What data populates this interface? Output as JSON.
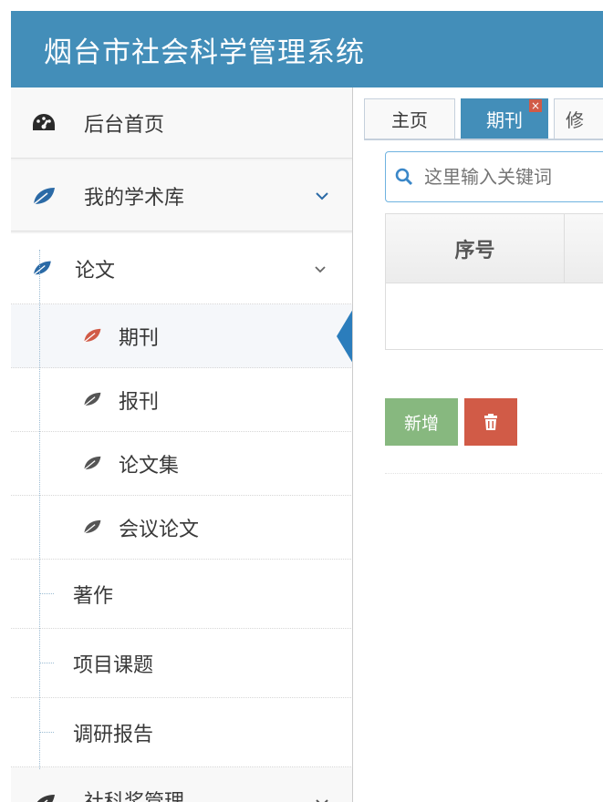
{
  "header": {
    "title": "烟台市社会科学管理系统",
    "bg_color": "#438eb9"
  },
  "sidebar": {
    "dashboard": {
      "label": "后台首页",
      "icon": "dashboard-icon"
    },
    "library": {
      "label": "我的学术库",
      "icon": "leaf-icon"
    },
    "paper": {
      "label": "论文",
      "icon": "leaf-icon"
    },
    "paper_items": [
      {
        "label": "期刊",
        "active": true
      },
      {
        "label": "报刊"
      },
      {
        "label": "论文集"
      },
      {
        "label": "会议论文"
      }
    ],
    "library_items": [
      {
        "label": "著作"
      },
      {
        "label": "项目课题"
      },
      {
        "label": "调研报告"
      }
    ],
    "award": {
      "label": "社科奖管理"
    }
  },
  "tabs": [
    {
      "label": "主页"
    },
    {
      "label": "期刊",
      "active": true,
      "close": "×"
    },
    {
      "label": "修"
    }
  ],
  "search": {
    "placeholder": "这里输入关键词"
  },
  "grid": {
    "col_seq": "序号"
  },
  "toolbar": {
    "add_label": "新增",
    "delete_icon": "trash-icon"
  },
  "colors": {
    "accent": "#438eb9",
    "active_leaf": "#d15b47",
    "leaf": "#555555",
    "add": "#87b87f",
    "delete": "#d15b47"
  }
}
